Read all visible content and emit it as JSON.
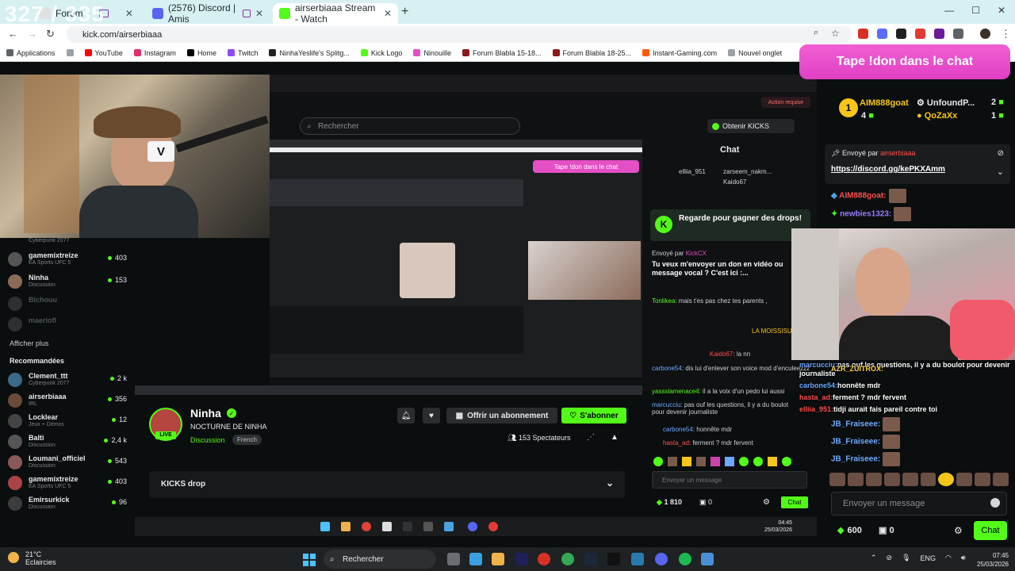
{
  "overlay_counter": "327 / 335",
  "browser": {
    "tabs": [
      {
        "title": "Forum",
        "active": false,
        "favicon_color": "#e0e0e0"
      },
      {
        "title": "(2576) Discord | Amis",
        "active": false,
        "favicon_color": "#5865f2"
      },
      {
        "title": "airserbiaaa Stream - Watch",
        "active": true,
        "favicon_color": "#53fc18"
      }
    ],
    "new_tab": "+",
    "url": "kick.com/airserbiaaa",
    "bookmarks": [
      {
        "label": "Applications",
        "icon_color": "#5f6368"
      },
      {
        "label": "YouTube",
        "icon_color": "#ff0000"
      },
      {
        "label": "Instagram",
        "icon_color": "#e1306c"
      },
      {
        "label": "Home",
        "icon_color": "#000000"
      },
      {
        "label": "Twitch",
        "icon_color": "#9146ff"
      },
      {
        "label": "NinhaYeslife's Splitg...",
        "icon_color": "#222222"
      },
      {
        "label": "Kick Logo",
        "icon_color": "#53fc18"
      },
      {
        "label": "Ninouille",
        "icon_color": "#e44fc6"
      },
      {
        "label": "Forum Blabla 15-18...",
        "icon_color": "#8a1a1a"
      },
      {
        "label": "Forum Blabla 18-25...",
        "icon_color": "#8a1a1a"
      },
      {
        "label": "Instant-Gaming.com",
        "icon_color": "#ff5a00"
      },
      {
        "label": "Nouvel onglet",
        "icon_color": "#9aa0a6"
      }
    ]
  },
  "don_banner": "Tape !don dans le chat",
  "captured": {
    "search_placeholder": "Rechercher",
    "get_kicks": "Obtenir KICKS",
    "chat_title": "Chat",
    "action_requise": "Action requise",
    "top_gifters": [
      "elliia_951",
      "zarseem_nakm...",
      "Kaido67"
    ],
    "drops_banner": "Regarde pour gagner des drops!",
    "pinned_from": "Envoyé par",
    "pinned_user": "KickCX",
    "pinned_text": "Tu veux m'envoyer un don en vidéo ou message vocal ? C'est ici :...",
    "chat_lines": [
      {
        "user": "Tonlikea",
        "color": "green",
        "text": "mais t'es pas chez tes parents ,"
      },
      {
        "user": "LA MOISSISURE OMFG",
        "color": "yellow",
        "text": ""
      },
      {
        "user": "Kaido67",
        "color": "red",
        "text": "la nn"
      },
      {
        "user": "carbone54",
        "color": "blue",
        "text": "dis lui d'enlever son voice mod d'enculeezzz"
      },
      {
        "user": "yassslamenace4",
        "color": "green",
        "text": "il a la voix d'un pedo lui aussi"
      },
      {
        "user": "marcucciu",
        "color": "blue",
        "text": "pas ouf les questions, il y a du boulot pour devenir journaliste"
      },
      {
        "user": "carbone54",
        "color": "blue",
        "text": "honnête mdr"
      },
      {
        "user": "hasta_ad",
        "color": "red",
        "text": "ferment ? mdr fervent"
      }
    ],
    "chat_placeholder": "Envoyer un message",
    "balance": "1 810",
    "box_count": "0",
    "chat_button": "Chat",
    "sidebar": {
      "items": [
        {
          "name": "Clement_ttt",
          "sub": "Cyberpunk 2077",
          "count": ""
        },
        {
          "name": "gamemixtreize",
          "sub": "EA Sports UFC 5",
          "count": "403"
        },
        {
          "name": "Ninha",
          "sub": "Discussion",
          "count": "153"
        },
        {
          "name": "Bichouu",
          "sub": "",
          "count": "",
          "dim": true
        },
        {
          "name": "maeriofl",
          "sub": "",
          "count": "",
          "dim": true
        }
      ],
      "show_more": "Afficher plus",
      "recommended_header": "Recommandées",
      "recommended": [
        {
          "name": "Clement_ttt",
          "sub": "Cyberpunk 2077",
          "count": "2 k"
        },
        {
          "name": "airserbiaaa",
          "sub": "IRL",
          "count": "356"
        },
        {
          "name": "Locklear",
          "sub": "Jeux + Démos",
          "count": "12"
        },
        {
          "name": "Balti",
          "sub": "Discussion",
          "count": "2,4 k"
        },
        {
          "name": "Loumani_officiel",
          "sub": "Discussion",
          "count": "543"
        },
        {
          "name": "gamemixtreize",
          "sub": "EA Sports UFC 5",
          "count": "403"
        },
        {
          "name": "Emirsurkick",
          "sub": "Discussion",
          "count": "96"
        }
      ]
    },
    "channel": {
      "name": "Ninha",
      "title": "NOCTURNE DE NINHA",
      "category": "Discussion",
      "language": "French",
      "live": "LIVE",
      "subscribe": "Offrir un abonnement",
      "follow": "S'abonner",
      "viewers": "153 Spectateurs",
      "kicks_drop": "KICKS drop"
    },
    "clock_time": "04:45",
    "clock_date": "25/03/2026"
  },
  "chat": {
    "gifters": [
      {
        "rank": "1",
        "name": "AIM888goat",
        "count": "4"
      },
      {
        "rank": "",
        "name": "UnfoundP...",
        "count": "2"
      },
      {
        "rank": "",
        "name": "QoZaXx",
        "count": "1"
      }
    ],
    "pinned_label": "Envoyé par",
    "pinned_user": "airserbiaaa",
    "pinned_link": "https://discord.gg/kePKXAmm",
    "messages_top": [
      {
        "user": "AIM888goat:",
        "color": "#ff4d4d"
      },
      {
        "user": "newbies1323:",
        "color": "#9b7bff"
      }
    ],
    "overlay_messages": [
      {
        "user": "marcucciu:",
        "text": "pas ouf les questions, il y a du boulot pour devenir journaliste"
      },
      {
        "user": "AZR_ZUITROX:",
        "text": ""
      },
      {
        "user": "carbone54:",
        "text": "honnête mdr"
      },
      {
        "user": "hasta_ad:",
        "text": "ferment ? mdr fervent"
      },
      {
        "user": "elliia_951:",
        "text": "tidji aurait fais pareil contre toi"
      }
    ],
    "fraise_lines": [
      "JB_Fraiseee:",
      "JB_Fraiseee:",
      "JB_Fraiseee:"
    ],
    "input_placeholder": "Envoyer un message",
    "balance": "600",
    "box_count": "0",
    "chat_button": "Chat"
  },
  "taskbar": {
    "weather_temp": "21°C",
    "weather_desc": "Eclaircies",
    "search": "Rechercher",
    "lang": "ENG",
    "time": "07:45",
    "date": "25/03/2026"
  }
}
